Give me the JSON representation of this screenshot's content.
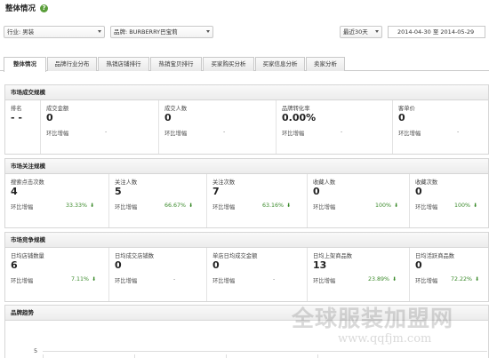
{
  "header": {
    "title": "整体情况"
  },
  "filters": {
    "industry": "行业: 男装",
    "brand": "品牌: BURBERRY巴宝莉",
    "period": "最近30天",
    "date_range": "2014-04-30 至 2014-05-29"
  },
  "tabs": [
    {
      "label": "整体情况",
      "active": true
    },
    {
      "label": "品牌行业分布"
    },
    {
      "label": "热销店铺排行"
    },
    {
      "label": "热销宝贝排行"
    },
    {
      "label": "买家购买分析"
    },
    {
      "label": "买家信息分析"
    },
    {
      "label": "卖家分析"
    }
  ],
  "compare_label": "环比增幅",
  "market_scale": {
    "title": "市场成交规模",
    "cells": [
      {
        "label": "排名",
        "value": "- -",
        "compare": "",
        "change": ""
      },
      {
        "label": "成交金额",
        "value": "0",
        "compare": "环比增幅",
        "change": "-"
      },
      {
        "label": "成交人数",
        "value": "0",
        "compare": "环比增幅",
        "change": "-"
      },
      {
        "label": "品牌转化率",
        "value": "0.00%",
        "compare": "环比增幅",
        "change": "-"
      },
      {
        "label": "客单价",
        "value": "0",
        "compare": "环比增幅",
        "change": "-"
      }
    ]
  },
  "market_attention": {
    "title": "市场关注规模",
    "cells": [
      {
        "label": "搜索点击次数",
        "value": "4",
        "compare": "环比增幅",
        "change": "33.33%"
      },
      {
        "label": "关注人数",
        "value": "5",
        "compare": "环比增幅",
        "change": "66.67%"
      },
      {
        "label": "关注次数",
        "value": "7",
        "compare": "环比增幅",
        "change": "63.16%"
      },
      {
        "label": "收藏人数",
        "value": "0",
        "compare": "环比增幅",
        "change": "100%"
      },
      {
        "label": "收藏次数",
        "value": "0",
        "compare": "环比增幅",
        "change": "100%"
      }
    ]
  },
  "market_competition": {
    "title": "市场竞争规模",
    "cells": [
      {
        "label": "日均店铺数量",
        "value": "6",
        "compare": "环比增幅",
        "change": "7.11%"
      },
      {
        "label": "日均成交店铺数",
        "value": "0",
        "compare": "环比增幅",
        "change": "-"
      },
      {
        "label": "单店日均成交金额",
        "value": "0",
        "compare": "环比增幅",
        "change": "-"
      },
      {
        "label": "日均上架商品数",
        "value": "13",
        "compare": "环比增幅",
        "change": "23.89%"
      },
      {
        "label": "日均活跃商品数",
        "value": "0",
        "compare": "环比增幅",
        "change": "72.22%"
      }
    ]
  },
  "trend": {
    "title": "品牌趋势",
    "y_tick": "5"
  },
  "watermark": {
    "text": "全球服装加盟网",
    "url": "www.qqfjm.com"
  }
}
